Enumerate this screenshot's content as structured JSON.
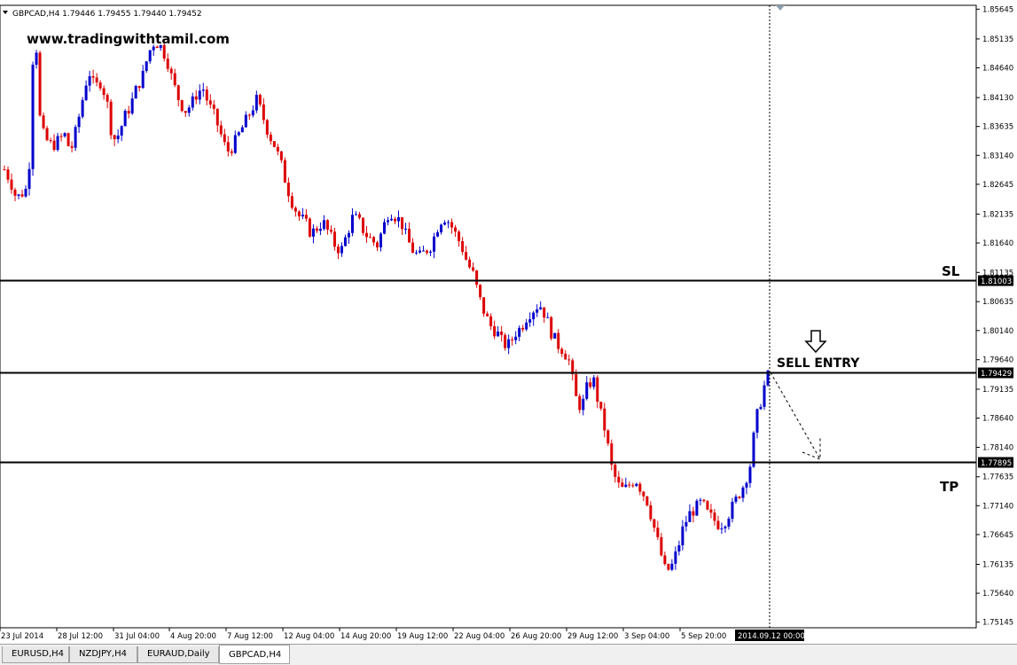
{
  "chart_header": "GBPCAD,H4  1.79446 1.79455 1.79440 1.79452",
  "watermark": "www.tradingwithtamil.com",
  "tabs": [
    {
      "label": "EURUSD,H4",
      "active": false
    },
    {
      "label": "NZDJPY,H4",
      "active": false
    },
    {
      "label": "EURAUD,Daily",
      "active": false
    },
    {
      "label": "GBPCAD,H4",
      "active": true
    }
  ],
  "chart_data": {
    "type": "candlestick",
    "symbol": "GBPCAD",
    "timeframe": "H4",
    "ylim": [
      1.7514,
      1.8565
    ],
    "y_ticks": [
      "1.85645",
      "1.85135",
      "1.84640",
      "1.84130",
      "1.83635",
      "1.83140",
      "1.82645",
      "1.82135",
      "1.81640",
      "1.81135",
      "1.80635",
      "1.80140",
      "1.79640",
      "1.79135",
      "1.78640",
      "1.78140",
      "1.77635",
      "1.77140",
      "1.76645",
      "1.76135",
      "1.75640",
      "1.75145"
    ],
    "x_ticks": [
      "23 Jul 2014",
      "28 Jul 12:00",
      "31 Jul 04:00",
      "4 Aug 20:00",
      "7 Aug 12:00",
      "12 Aug 04:00",
      "14 Aug 20:00",
      "19 Aug 12:00",
      "22 Aug 04:00",
      "26 Aug 20:00",
      "29 Aug 12:00",
      "3 Sep 04:00",
      "5 Sep 20:00"
    ],
    "cursor_time": "2014.09.12 00:00",
    "up_color": "#0000cc",
    "down_color": "#dd0000",
    "levels": [
      {
        "label": "SL",
        "price": 1.81003,
        "price_label": "1.81003"
      },
      {
        "label": "SELL ENTRY",
        "price": 1.79429,
        "price_label": "1.79429"
      },
      {
        "label": "TP",
        "price": 1.77895,
        "price_label": "1.77895"
      }
    ],
    "path": [
      [
        1.829,
        1.827
      ],
      [
        1.824,
        1.825
      ],
      [
        1.826,
        1.856
      ],
      [
        1.836,
        1.834
      ],
      [
        1.833,
        1.834
      ],
      [
        1.835,
        1.832
      ],
      [
        1.836,
        1.841
      ],
      [
        1.846,
        1.843
      ],
      [
        1.844,
        1.841
      ],
      [
        1.834,
        1.835
      ],
      [
        1.838,
        1.84
      ],
      [
        1.843,
        1.845
      ],
      [
        1.849,
        1.851
      ],
      [
        1.85,
        1.848
      ],
      [
        1.844,
        1.841
      ],
      [
        1.839,
        1.84
      ],
      [
        1.842,
        1.843
      ],
      [
        1.84,
        1.838
      ],
      [
        1.835,
        1.832
      ],
      [
        1.833,
        1.835
      ],
      [
        1.837,
        1.839
      ],
      [
        1.841,
        1.838
      ],
      [
        1.835,
        1.833
      ],
      [
        1.83,
        1.826
      ],
      [
        1.823,
        1.821
      ],
      [
        1.82,
        1.818
      ],
      [
        1.819,
        1.82
      ],
      [
        1.818,
        1.816
      ],
      [
        1.815,
        1.818
      ],
      [
        1.821,
        1.82
      ],
      [
        1.818,
        1.817
      ],
      [
        1.816,
        1.819
      ],
      [
        1.822,
        1.821
      ],
      [
        1.82,
        1.817
      ],
      [
        1.815,
        1.814
      ],
      [
        1.815,
        1.816
      ],
      [
        1.819,
        1.821
      ],
      [
        1.82,
        1.818
      ],
      [
        1.816,
        1.813
      ],
      [
        1.811,
        1.807
      ],
      [
        1.804,
        1.802
      ],
      [
        1.801,
        1.799
      ],
      [
        1.799,
        1.801
      ],
      [
        1.802,
        1.804
      ],
      [
        1.805,
        1.806
      ],
      [
        1.804,
        1.801
      ],
      [
        1.799,
        1.798
      ],
      [
        1.796,
        1.79
      ],
      [
        1.788,
        1.792
      ],
      [
        1.793,
        1.788
      ],
      [
        1.784,
        1.778
      ],
      [
        1.775,
        1.774
      ],
      [
        1.775,
        1.776
      ],
      [
        1.774,
        1.772
      ],
      [
        1.768,
        1.764
      ],
      [
        1.76,
        1.761
      ],
      [
        1.764,
        1.768
      ],
      [
        1.77,
        1.771
      ],
      [
        1.772,
        1.77
      ],
      [
        1.769,
        1.768
      ],
      [
        1.769,
        1.771
      ],
      [
        1.773,
        1.775
      ],
      [
        1.778,
        1.786
      ],
      [
        1.79,
        1.7945
      ]
    ]
  }
}
